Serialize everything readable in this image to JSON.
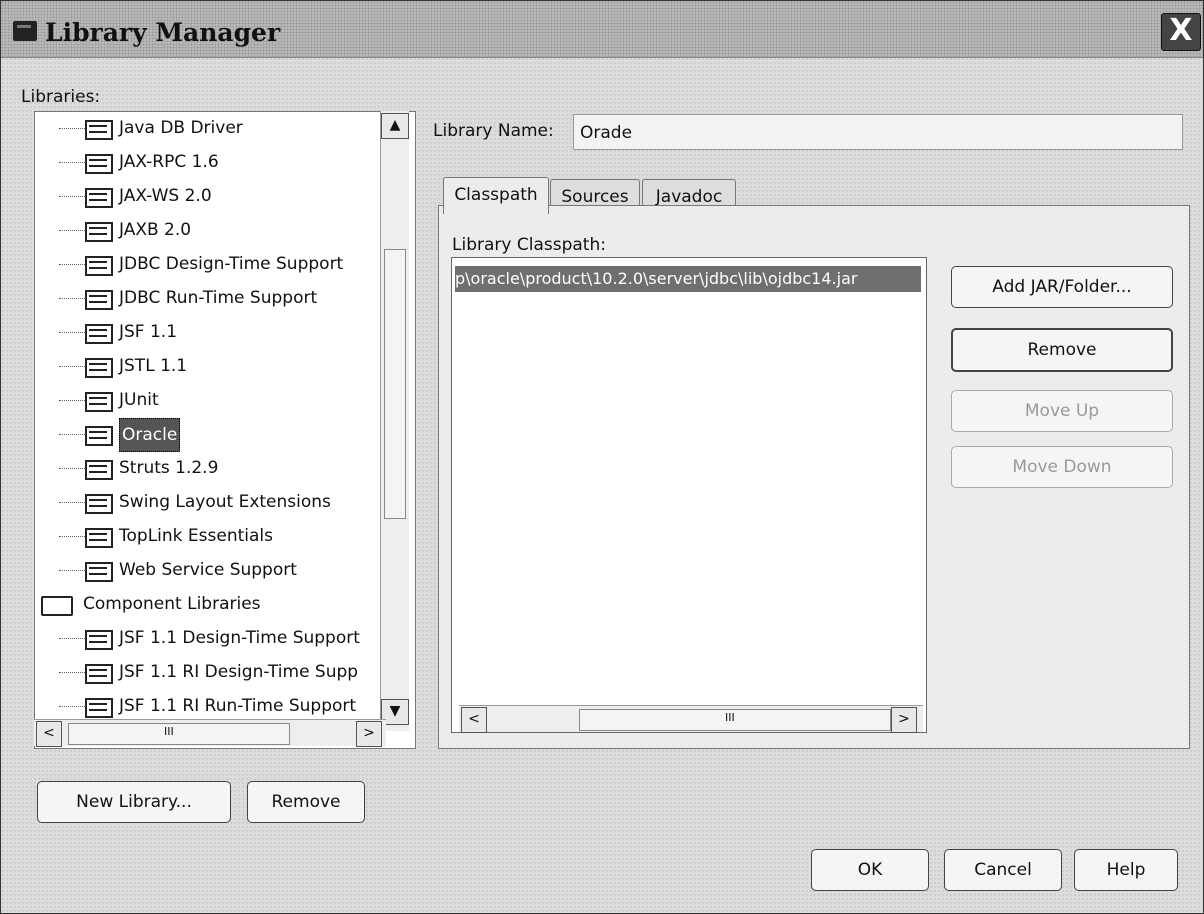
{
  "window": {
    "title": "Library Manager",
    "close_glyph": "X"
  },
  "left": {
    "libraries_label": "Libraries:",
    "items": [
      {
        "label": "Java DB Driver"
      },
      {
        "label": "JAX-RPC 1.6"
      },
      {
        "label": "JAX-WS 2.0"
      },
      {
        "label": "JAXB 2.0"
      },
      {
        "label": "JDBC Design-Time Support"
      },
      {
        "label": "JDBC Run-Time Support"
      },
      {
        "label": "JSF 1.1"
      },
      {
        "label": "JSTL 1.1"
      },
      {
        "label": "JUnit"
      },
      {
        "label": "Oracle"
      },
      {
        "label": "Struts 1.2.9"
      },
      {
        "label": "Swing Layout Extensions"
      },
      {
        "label": "TopLink Essentials"
      },
      {
        "label": "Web Service Support"
      },
      {
        "label": "Component Libraries"
      },
      {
        "label": "JSF 1.1 Design-Time Support"
      },
      {
        "label": "JSF 1.1 RI Design-Time Supp"
      },
      {
        "label": "JSF 1.1 RI Run-Time Support"
      }
    ],
    "scroll": {
      "up": "▲",
      "down": "▼",
      "left": "<",
      "right": ">",
      "grip": "III"
    },
    "new_library_button": "New Library...",
    "remove_button": "Remove"
  },
  "right": {
    "library_name_label": "Library Name:",
    "library_name_value": "Orade",
    "tabs": [
      "Classpath",
      "Sources",
      "Javadoc"
    ],
    "classpath_label": "Library Classpath:",
    "classpath_entries": [
      "p\\oracle\\product\\10.2.0\\server\\jdbc\\lib\\ojdbc14.jar"
    ],
    "buttons": {
      "add": "Add JAR/Folder...",
      "remove": "Remove",
      "move_up": "Move Up",
      "move_down": "Move Down"
    },
    "scroll": {
      "left": "<",
      "right": ">",
      "grip": "III"
    }
  },
  "footer": {
    "ok": "OK",
    "cancel": "Cancel",
    "help": "Help"
  }
}
